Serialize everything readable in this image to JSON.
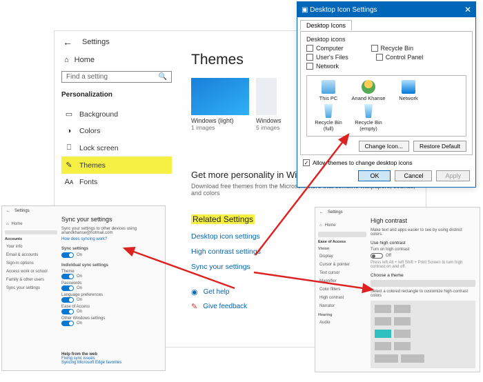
{
  "main": {
    "top_title": "Settings",
    "home": "Home",
    "search_placeholder": "Find a setting",
    "section": "Personalization",
    "nav": [
      {
        "icon": "▭",
        "label": "Background"
      },
      {
        "icon": "◑",
        "label": "Colors"
      },
      {
        "icon": "⎕",
        "label": "Lock screen"
      },
      {
        "icon": "✎",
        "label": "Themes"
      },
      {
        "icon": "Aᴀ",
        "label": "Fonts"
      }
    ],
    "page_title": "Themes",
    "themes": [
      {
        "name": "Windows (light)",
        "sub": "1 images"
      },
      {
        "name": "Windows",
        "sub": "5 images"
      }
    ],
    "personality_title": "Get more personality in Windows",
    "personality_desc": "Download free themes from the Microsoft Store that combine wallpapers, sounds, and colors",
    "related_hdr": "Related Settings",
    "links": {
      "desktop_icons": "Desktop icon settings",
      "high_contrast": "High contrast settings",
      "sync": "Sync your settings"
    },
    "get_help": "Get help",
    "give_feedback": "Give feedback"
  },
  "dlg": {
    "title": "Desktop Icon Settings",
    "tab": "Desktop Icons",
    "group_label": "Desktop icons",
    "checks": {
      "computer": "Computer",
      "recycle_bin": "Recycle Bin",
      "users_files": "User's Files",
      "control_panel": "Control Panel",
      "network": "Network"
    },
    "icons": [
      "This PC",
      "Anand Khanse",
      "Network",
      "Recycle Bin (full)",
      "Recycle Bin (empty)"
    ],
    "change_icon": "Change Icon...",
    "restore_default": "Restore Default",
    "allow_themes": "Allow themes to change desktop icons",
    "ok": "OK",
    "cancel": "Cancel",
    "apply": "Apply"
  },
  "sync": {
    "top_title": "Settings",
    "home": "Home",
    "section": "Accounts",
    "nav": [
      "Your info",
      "Email & accounts",
      "Sign-in options",
      "Access work or school",
      "Family & other users",
      "Sync your settings"
    ],
    "title": "Sync your settings",
    "desc": "Sync your settings to other devices using anandkhanse@hotmail.com",
    "how_link": "How does syncing work?",
    "toggle_hdr": "Sync settings",
    "on": "On",
    "ind_hdr": "Individual sync settings",
    "items": [
      "Theme",
      "Passwords",
      "Language preferences",
      "Ease of Access",
      "Other Windows settings"
    ],
    "help_hdr": "Help from the web",
    "help1": "Fixing sync issues",
    "help2": "Syncing Microsoft Edge favorites"
  },
  "hc": {
    "top_title": "Settings",
    "home": "Home",
    "section": "Ease of Access",
    "groups": {
      "vision": "Vision",
      "hearing": "Hearing"
    },
    "nav": [
      "Display",
      "Cursor & pointer",
      "Text cursor",
      "Magnifier",
      "Color filters",
      "High contrast",
      "Narrator",
      "Audio"
    ],
    "title": "High contrast",
    "desc": "Make text and apps easier to see by using distinct colors.",
    "use_hdr": "Use high contrast",
    "turn_on": "Turn on high contrast",
    "off": "Off",
    "hint": "Press left Alt + left Shift + Print Screen to turn high contrast on and off.",
    "choose_theme": "Choose a theme",
    "select_color": "Select a colored rectangle to customize high-contrast colors"
  }
}
